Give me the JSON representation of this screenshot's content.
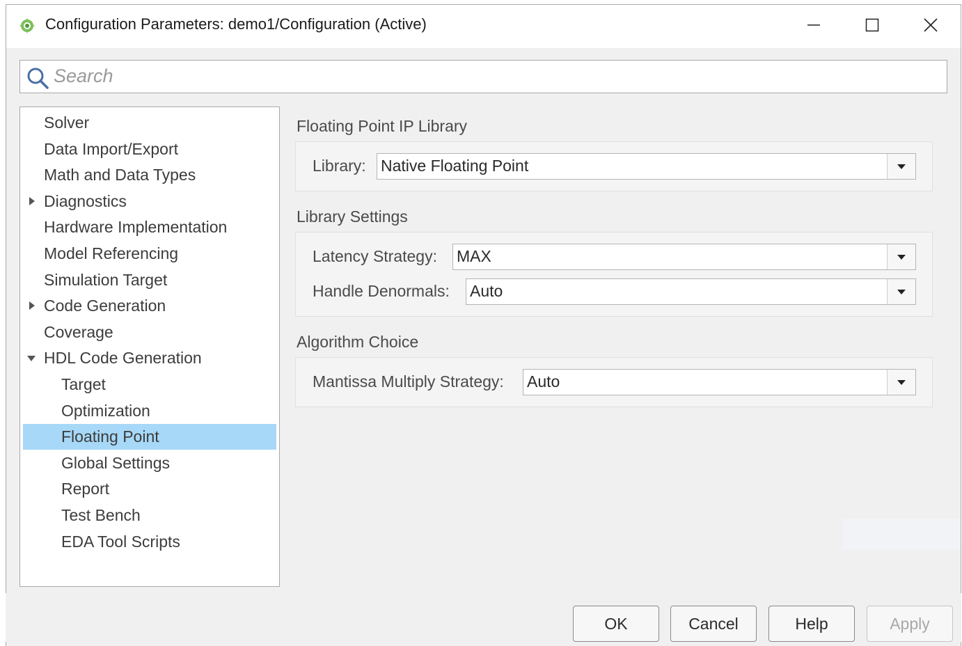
{
  "window": {
    "title": "Configuration Parameters: demo1/Configuration (Active)",
    "controls": {
      "minimize": "minimize",
      "maximize": "maximize",
      "close": "close"
    }
  },
  "search": {
    "placeholder": "Search",
    "value": ""
  },
  "tree": {
    "items": [
      {
        "label": "Solver",
        "level": 0,
        "expander": "none"
      },
      {
        "label": "Data Import/Export",
        "level": 0,
        "expander": "none"
      },
      {
        "label": "Math and Data Types",
        "level": 0,
        "expander": "none"
      },
      {
        "label": "Diagnostics",
        "level": 0,
        "expander": "collapsed"
      },
      {
        "label": "Hardware Implementation",
        "level": 0,
        "expander": "none"
      },
      {
        "label": "Model Referencing",
        "level": 0,
        "expander": "none"
      },
      {
        "label": "Simulation Target",
        "level": 0,
        "expander": "none"
      },
      {
        "label": "Code Generation",
        "level": 0,
        "expander": "collapsed"
      },
      {
        "label": "Coverage",
        "level": 0,
        "expander": "none"
      },
      {
        "label": "HDL Code Generation",
        "level": 0,
        "expander": "expanded"
      },
      {
        "label": "Target",
        "level": 1,
        "expander": "none"
      },
      {
        "label": "Optimization",
        "level": 1,
        "expander": "none"
      },
      {
        "label": "Floating Point",
        "level": 1,
        "expander": "none",
        "selected": true
      },
      {
        "label": "Global Settings",
        "level": 1,
        "expander": "none"
      },
      {
        "label": "Report",
        "level": 1,
        "expander": "none"
      },
      {
        "label": "Test Bench",
        "level": 1,
        "expander": "none"
      },
      {
        "label": "EDA Tool Scripts",
        "level": 1,
        "expander": "none"
      }
    ]
  },
  "sections": {
    "ip_library": {
      "title": "Floating Point IP Library",
      "library_label": "Library:",
      "library_value": "Native Floating Point"
    },
    "library_settings": {
      "title": "Library Settings",
      "latency_label": "Latency Strategy:",
      "latency_value": "MAX",
      "denormals_label": "Handle Denormals:",
      "denormals_value": "Auto"
    },
    "algorithm": {
      "title": "Algorithm Choice",
      "mantissa_label": "Mantissa Multiply Strategy:",
      "mantissa_value": "Auto"
    }
  },
  "buttons": {
    "ok": "OK",
    "cancel": "Cancel",
    "help": "Help",
    "apply": "Apply"
  },
  "colors": {
    "selection": "#a7d8f7",
    "window_bg": "#f0f0f0",
    "border": "#a9a9a9"
  }
}
